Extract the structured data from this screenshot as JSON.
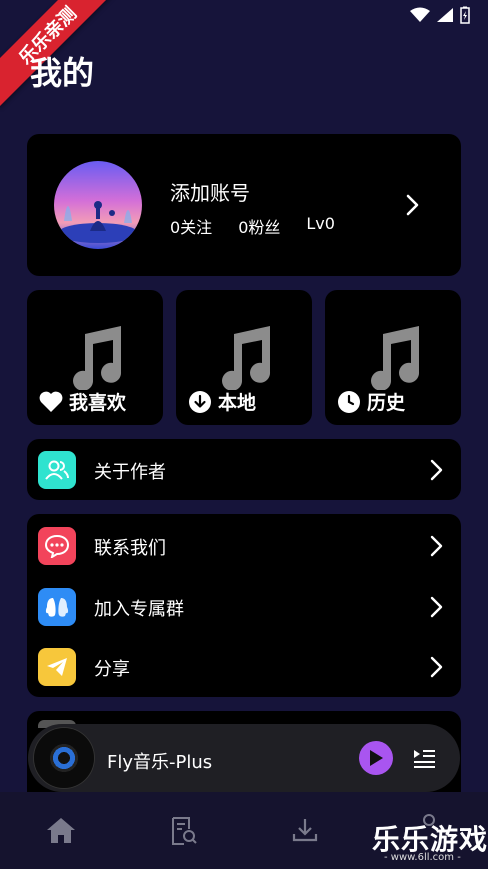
{
  "ribbon_text": "乐乐亲测",
  "page_title": "我的",
  "account": {
    "name": "添加账号",
    "follow": "0关注",
    "fans": "0粉丝",
    "level": "Lv0"
  },
  "tiles": [
    {
      "label": "我喜欢",
      "icon": "heart-icon"
    },
    {
      "label": "本地",
      "icon": "download-circle-icon"
    },
    {
      "label": "历史",
      "icon": "clock-icon"
    }
  ],
  "menu": {
    "about": {
      "label": "关于作者",
      "icon": "contacts-icon",
      "color": "#2fe3cf"
    },
    "contact": {
      "label": "联系我们",
      "icon": "chat-bubble-icon",
      "color": "#f2445b"
    },
    "join_group": {
      "label": "加入专属群",
      "icon": "qq-icon",
      "color": "#2e8cf5"
    },
    "share": {
      "label": "分享",
      "icon": "send-icon",
      "color": "#f7c73b"
    }
  },
  "player": {
    "title": "Fly音乐-Plus",
    "accent": "#a955f0"
  },
  "nav": [
    "home-icon",
    "search-list-icon",
    "download-icon",
    "music-icon"
  ],
  "watermark": {
    "main": "乐乐游戏",
    "sub": "- www.6ll.com -"
  }
}
